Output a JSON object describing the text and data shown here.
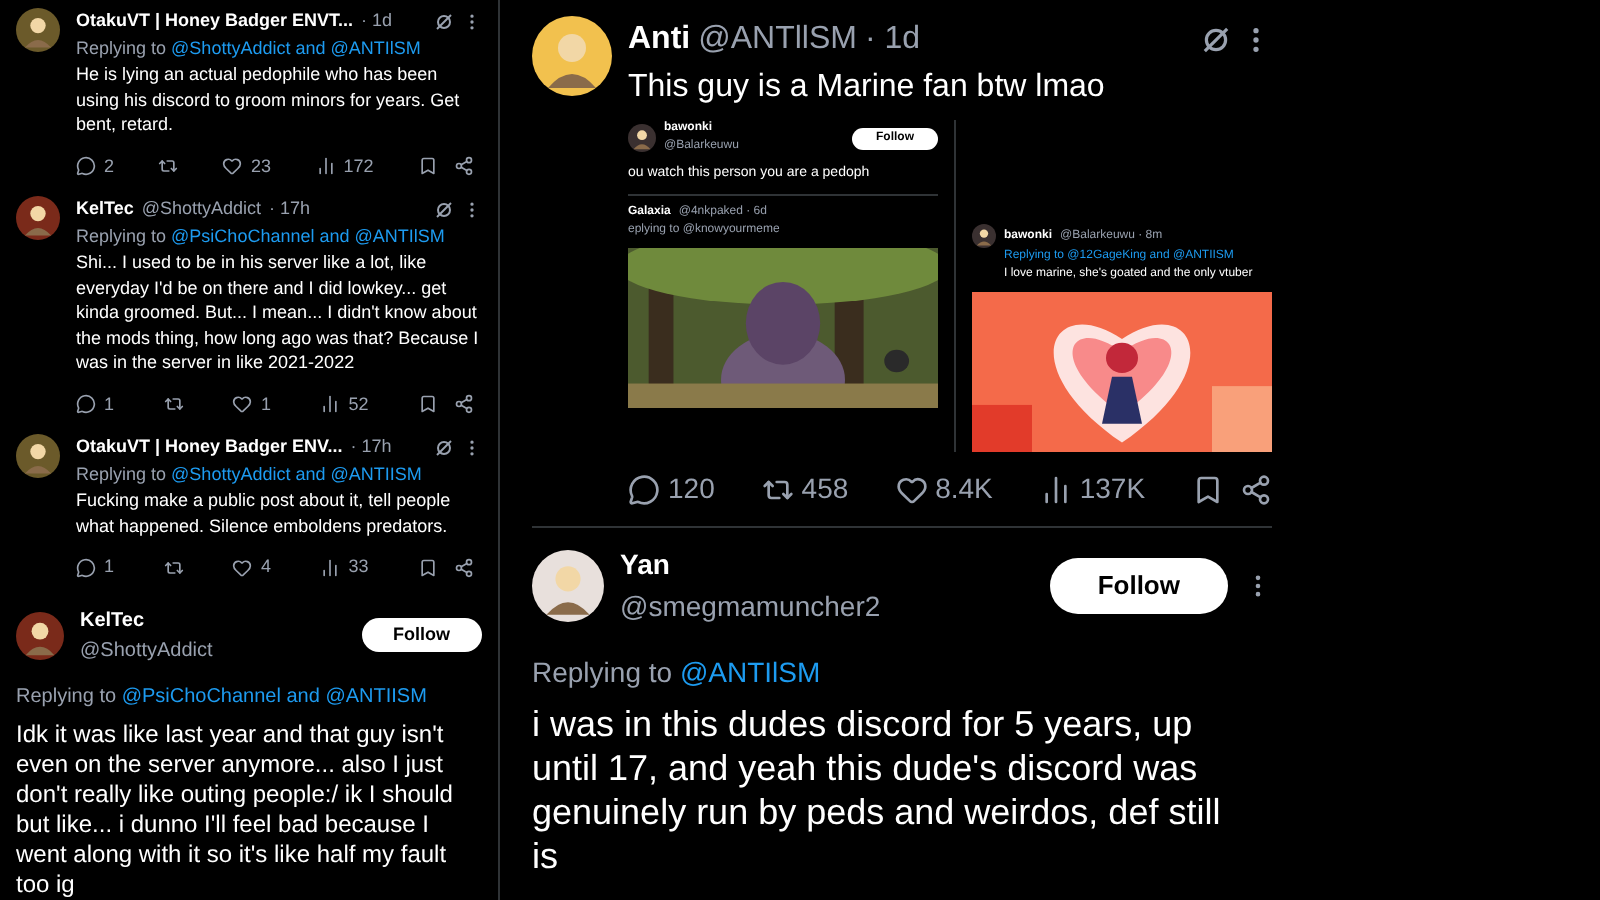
{
  "left_thread": [
    {
      "kind": "reply",
      "name": "OtakuVT | Honey Badger ENVT...",
      "time": "· 1d",
      "replying_prefix": "Replying to",
      "replying_to": "@ShottyAddict and @ANTIlSM",
      "text": "He is lying an actual pedophile who has been using his discord to groom minors for years. Get bent, retard.",
      "stats": {
        "replies": "2",
        "likes": "23",
        "views": "172"
      }
    },
    {
      "kind": "reply",
      "name": "KelTec",
      "handle": "@ShottyAddict",
      "time": "· 17h",
      "replying_prefix": "Replying to",
      "replying_to": "@PsiChoChannel and @ANTIlSM",
      "text": "Shi... I used to be in his server like a lot, like everyday I'd be on there and I did lowkey... get kinda groomed. But... I mean... I didn't know about the mods thing, how long ago was that? Because I was in the server in like 2021-2022",
      "stats": {
        "replies": "1",
        "likes": "1",
        "views": "52"
      }
    },
    {
      "kind": "reply",
      "name": "OtakuVT | Honey Badger ENV...",
      "time": "· 17h",
      "replying_prefix": "Replying to",
      "replying_to": "@ShottyAddict and @ANTIISM",
      "text": "Fucking make a public post about it, tell people what happened. Silence emboldens predators.",
      "stats": {
        "replies": "1",
        "likes": "4",
        "views": "33"
      }
    },
    {
      "kind": "focused",
      "name": "KelTec",
      "handle": "@ShottyAddict",
      "follow": "Follow",
      "replying_prefix": "Replying to",
      "replying_to": "@PsiChoChannel and @ANTIISM",
      "text": "Idk it was like last year and that guy isn't even on the server anymore... also I just don't really like outing people:/ ik I should but like... i dunno I'll feel bad because I went along with it so it's like half my fault too ig"
    }
  ],
  "main_tweet": {
    "name": "Anti",
    "handle": "@ANTllSM",
    "time": "· 1d",
    "text": "This guy is a Marine fan btw lmao",
    "embed_left": {
      "name": "bawonki",
      "handle": "@Balarkeuwu",
      "follow": "Follow",
      "text": "ou watch this person you are a pedoph",
      "quoted_name": "Galaxia",
      "quoted_meta": "@4nkpaked · 6d",
      "quoted_reply": "eplying to @knowyourmeme"
    },
    "embed_right": {
      "name": "bawonki",
      "meta": "@Balarkeuwu · 8m",
      "replying": "Replying to @12GageKing and @ANTIISM",
      "text": "I love marine, she's goated and the only vtuber"
    },
    "stats": {
      "replies": "120",
      "reposts": "458",
      "likes": "8.4K",
      "views": "137K"
    }
  },
  "reply_tweet": {
    "name": "Yan",
    "handle": "@smegmamuncher2",
    "follow": "Follow",
    "replying_prefix": "Replying to",
    "replying_to": "@ANTIlSM",
    "text": "i was in this dudes discord for 5 years, up until 17, and yeah this dude's discord was genuinely run by peds and weirdos, def still is"
  }
}
